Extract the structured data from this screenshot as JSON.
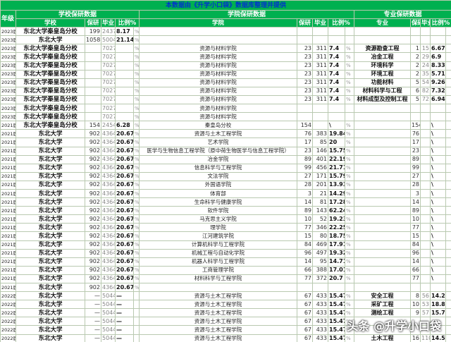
{
  "banner": "本数据由《升学小口袋》数据库整理并提供",
  "headers": {
    "year": "年级",
    "school_group": "学校保研数据",
    "college_group": "学院保研数据",
    "major_group": "专业保研数据",
    "school": "学校",
    "baoyan": "保研",
    "biye": "毕业",
    "ratio": "比例%",
    "college": "学院",
    "major": "专业"
  },
  "rows": [
    {
      "y": "2023届",
      "s": "东北大学秦皇岛分校",
      "sb": "199",
      "sg": "2437",
      "sr": "8.17",
      "sp": "%",
      "c": "",
      "cb": "",
      "cg": "",
      "cr": "",
      "cp": "",
      "m": "",
      "mb": "",
      "mg": "",
      "mr": "",
      "mp": ""
    },
    {
      "y": "2023届",
      "s": "东北大学",
      "sb": "1058",
      "sg": "5004",
      "sr": "21.14",
      "sp": "%",
      "c": "",
      "cb": "",
      "cg": "",
      "cr": "",
      "cp": "",
      "m": "",
      "mb": "",
      "mg": "",
      "mr": "",
      "mp": ""
    },
    {
      "y": "2023届",
      "s": "东北大学秦皇岛分校",
      "sb": "",
      "sg": "7027",
      "sr": "",
      "sp": "%",
      "c": "资源与材料学院",
      "cb": "23",
      "cg": "311",
      "cr": "7.4",
      "cp": "%",
      "m": "资源勘查工程",
      "mb": "1",
      "mg": "15",
      "mr": "6.67",
      "mp": ""
    },
    {
      "y": "2023届",
      "s": "东北大学秦皇岛分校",
      "sb": "",
      "sg": "7027",
      "sr": "",
      "sp": "%",
      "c": "资源与材料学院",
      "cb": "23",
      "cg": "311",
      "cr": "7.4",
      "cp": "%",
      "m": "冶金工程",
      "mb": "2",
      "mg": "29",
      "mr": "6.9",
      "mp": ""
    },
    {
      "y": "2023届",
      "s": "东北大学秦皇岛分校",
      "sb": "",
      "sg": "7027",
      "sr": "",
      "sp": "%",
      "c": "资源与材料学院",
      "cb": "23",
      "cg": "311",
      "cr": "7.4",
      "cp": "%",
      "m": "环境科学",
      "mb": "2",
      "mg": "24",
      "mr": "8.33",
      "mp": ""
    },
    {
      "y": "2023届",
      "s": "东北大学秦皇岛分校",
      "sb": "",
      "sg": "7027",
      "sr": "",
      "sp": "%",
      "c": "资源与材料学院",
      "cb": "23",
      "cg": "311",
      "cr": "7.4",
      "cp": "%",
      "m": "环境工程",
      "mb": "2",
      "mg": "35",
      "mr": "5.71",
      "mp": ""
    },
    {
      "y": "2023届",
      "s": "东北大学秦皇岛分校",
      "sb": "",
      "sg": "7027",
      "sr": "",
      "sp": "%",
      "c": "资源与材料学院",
      "cb": "23",
      "cg": "311",
      "cr": "7.4",
      "cp": "%",
      "m": "功能材料",
      "mb": "5",
      "mg": "54",
      "mr": "9.26",
      "mp": ""
    },
    {
      "y": "2023届",
      "s": "东北大学秦皇岛分校",
      "sb": "",
      "sg": "7027",
      "sr": "",
      "sp": "%",
      "c": "资源与材料学院",
      "cb": "23",
      "cg": "311",
      "cr": "7.4",
      "cp": "%",
      "m": "材料科学与工程",
      "mb": "6",
      "mg": "82",
      "mr": "7.32",
      "mp": ""
    },
    {
      "y": "2023届",
      "s": "东北大学秦皇岛分校",
      "sb": "",
      "sg": "7027",
      "sr": "",
      "sp": "%",
      "c": "资源与材料学院",
      "cb": "23",
      "cg": "311",
      "cr": "7.4",
      "cp": "%",
      "m": "材料成型及控制工程",
      "mb": "5",
      "mg": "72",
      "mr": "6.94",
      "mp": ""
    },
    {
      "y": "2023届",
      "s": "东北大学秦皇岛分校",
      "sb": "",
      "sg": "7027",
      "sr": "",
      "sp": "%",
      "c": "资源与材料学院",
      "cb": "",
      "cg": "",
      "cr": "",
      "cp": "",
      "m": "",
      "mb": "",
      "mg": "",
      "mr": "",
      "mp": ""
    },
    {
      "y": "2023届",
      "s": "东北大学秦皇岛分校",
      "sb": "",
      "sg": "7027",
      "sr": "",
      "sp": "%",
      "c": "资源与材料学院",
      "cb": "",
      "cg": "",
      "cr": "",
      "cp": "",
      "m": "",
      "mb": "",
      "mg": "",
      "mr": "",
      "mp": ""
    },
    {
      "y": "2021届",
      "s": "东北大学秦皇岛分校",
      "sb": "154",
      "sg": "2454",
      "sr": "6.28",
      "sp": "%",
      "c": "秦皇岛分校",
      "cb": "154",
      "cg": "",
      "cr": "\\",
      "cp": "%",
      "m": "",
      "mb": "154",
      "mg": "",
      "mr": "\\",
      "mp": ""
    },
    {
      "y": "2021届",
      "s": "东北大学",
      "sb": "902",
      "sg": "4364",
      "sr": "20.67",
      "sp": "%",
      "c": "资源与土木工程学院",
      "cb": "76",
      "cg": "383",
      "cr": "19.84",
      "cp": "%",
      "m": "",
      "mb": "76",
      "mg": "",
      "mr": "\\",
      "mp": ""
    },
    {
      "y": "2021届",
      "s": "东北大学",
      "sb": "902",
      "sg": "4364",
      "sr": "20.67",
      "sp": "%",
      "c": "艺术学院",
      "cb": "17",
      "cg": "85",
      "cr": "20",
      "cp": "%",
      "m": "",
      "mb": "17",
      "mg": "",
      "mr": "\\",
      "mp": ""
    },
    {
      "y": "2021届",
      "s": "东北大学",
      "sb": "902",
      "sg": "4364",
      "sr": "20.67",
      "sp": "%",
      "c": "医学与生物信息工程学院（原中荷生物医学与信息工程学院）",
      "cb": "23",
      "cg": "146",
      "cr": "15.75",
      "cp": "%",
      "m": "",
      "mb": "23",
      "mg": "",
      "mr": "\\",
      "mp": ""
    },
    {
      "y": "2021届",
      "s": "东北大学",
      "sb": "902",
      "sg": "4364",
      "sr": "20.67",
      "sp": "%",
      "c": "冶金学院",
      "cb": "89",
      "cg": "401",
      "cr": "22.19",
      "cp": "%",
      "m": "",
      "mb": "89",
      "mg": "",
      "mr": "\\",
      "mp": ""
    },
    {
      "y": "2021届",
      "s": "东北大学",
      "sb": "902",
      "sg": "4364",
      "sr": "20.67",
      "sp": "%",
      "c": "信息科学与工程学院",
      "cb": "99",
      "cg": "456",
      "cr": "21.71",
      "cp": "%",
      "m": "",
      "mb": "99",
      "mg": "",
      "mr": "\\",
      "mp": ""
    },
    {
      "y": "2021届",
      "s": "东北大学",
      "sb": "902",
      "sg": "4364",
      "sr": "20.67",
      "sp": "%",
      "c": "文法学院",
      "cb": "27",
      "cg": "171",
      "cr": "15.79",
      "cp": "%",
      "m": "",
      "mb": "27",
      "mg": "",
      "mr": "\\",
      "mp": ""
    },
    {
      "y": "2021届",
      "s": "东北大学",
      "sb": "902",
      "sg": "4364",
      "sr": "20.67",
      "sp": "%",
      "c": "外国语学院",
      "cb": "28",
      "cg": "201",
      "cr": "13.93",
      "cp": "%",
      "m": "",
      "mb": "28",
      "mg": "",
      "mr": "\\",
      "mp": ""
    },
    {
      "y": "2021届",
      "s": "东北大学",
      "sb": "902",
      "sg": "4364",
      "sr": "20.67",
      "sp": "%",
      "c": "体育部",
      "cb": "3",
      "cg": "21",
      "cr": "14.29",
      "cp": "%",
      "m": "",
      "mb": "3",
      "mg": "",
      "mr": "\\",
      "mp": ""
    },
    {
      "y": "2021届",
      "s": "东北大学",
      "sb": "902",
      "sg": "4364",
      "sr": "20.67",
      "sp": "%",
      "c": "生命科学与健康学院",
      "cb": "14",
      "cg": "81",
      "cr": "17.28",
      "cp": "%",
      "m": "",
      "mb": "14",
      "mg": "",
      "mr": "\\",
      "mp": ""
    },
    {
      "y": "2021届",
      "s": "东北大学",
      "sb": "902",
      "sg": "4364",
      "sr": "20.67",
      "sp": "%",
      "c": "软件学院",
      "cb": "89",
      "cg": "143",
      "cr": "62.24",
      "cp": "%",
      "m": "",
      "mb": "89",
      "mg": "",
      "mr": "\\",
      "mp": ""
    },
    {
      "y": "2021届",
      "s": "东北大学",
      "sb": "902",
      "sg": "4364",
      "sr": "20.67",
      "sp": "%",
      "c": "马克思主义学院",
      "cb": "10",
      "cg": "52",
      "cr": "19.23",
      "cp": "%",
      "m": "",
      "mb": "10",
      "mg": "",
      "mr": "\\",
      "mp": ""
    },
    {
      "y": "2021届",
      "s": "东北大学",
      "sb": "902",
      "sg": "4364",
      "sr": "20.67",
      "sp": "%",
      "c": "理学院",
      "cb": "77",
      "cg": "346",
      "cr": "22.25",
      "cp": "%",
      "m": "",
      "mb": "77",
      "mg": "",
      "mr": "\\",
      "mp": ""
    },
    {
      "y": "2021届",
      "s": "东北大学",
      "sb": "902",
      "sg": "4364",
      "sr": "20.67",
      "sp": "%",
      "c": "江河建筑学院",
      "cb": "15",
      "cg": "80",
      "cr": "18.75",
      "cp": "%",
      "m": "",
      "mb": "15",
      "mg": "",
      "mr": "\\",
      "mp": ""
    },
    {
      "y": "2021届",
      "s": "东北大学",
      "sb": "902",
      "sg": "4364",
      "sr": "20.67",
      "sp": "%",
      "c": "计算机科学与工程学院",
      "cb": "84",
      "cg": "469",
      "cr": "17.91",
      "cp": "%",
      "m": "",
      "mb": "84",
      "mg": "",
      "mr": "\\",
      "mp": ""
    },
    {
      "y": "2021届",
      "s": "东北大学",
      "sb": "902",
      "sg": "4364",
      "sr": "20.67",
      "sp": "%",
      "c": "机械工程与自动化学院",
      "cb": "96",
      "cg": "497",
      "cr": "19.32",
      "cp": "%",
      "m": "",
      "mb": "96",
      "mg": "",
      "mr": "\\",
      "mp": ""
    },
    {
      "y": "2021届",
      "s": "东北大学",
      "sb": "902",
      "sg": "4364",
      "sr": "20.67",
      "sp": "%",
      "c": "机器人科学与工程学院",
      "cb": "14",
      "cg": "95",
      "cr": "14.71",
      "cp": "%",
      "m": "",
      "mb": "14",
      "mg": "",
      "mr": "\\",
      "mp": ""
    },
    {
      "y": "2021届",
      "s": "东北大学",
      "sb": "902",
      "sg": "4364",
      "sr": "20.67",
      "sp": "%",
      "c": "工商管理学院",
      "cb": "66",
      "cg": "388",
      "cr": "17.01",
      "cp": "%",
      "m": "",
      "mb": "66",
      "mg": "",
      "mr": "\\",
      "mp": ""
    },
    {
      "y": "2021届",
      "s": "东北大学",
      "sb": "902",
      "sg": "4364",
      "sr": "20.67",
      "sp": "%",
      "c": "材料科学与工程学院",
      "cb": "77",
      "cg": "372",
      "cr": "20.7",
      "cp": "%",
      "m": "",
      "mb": "77",
      "mg": "",
      "mr": "\\",
      "mp": ""
    },
    {
      "y": "2021届",
      "s": "东北大学",
      "sb": "902",
      "sg": "4364",
      "sr": "20.67",
      "sp": "%",
      "c": "",
      "cb": "",
      "cg": "",
      "cr": "",
      "cp": "",
      "m": "",
      "mb": "",
      "mg": "",
      "mr": "",
      "mp": ""
    },
    {
      "y": "2022届",
      "s": "东北大学",
      "sb": "—",
      "sg": "5044",
      "sr": "—",
      "sp": "",
      "c": "资源与土木工程学院",
      "cb": "67",
      "cg": "433",
      "cr": "15.47",
      "cp": "%",
      "m": "安全工程",
      "mb": "8",
      "mg": "56",
      "mr": "14.29",
      "mp": ""
    },
    {
      "y": "2022届",
      "s": "东北大学",
      "sb": "—",
      "sg": "5044",
      "sr": "—",
      "sp": "",
      "c": "资源与土木工程学院",
      "cb": "67",
      "cg": "433",
      "cr": "15.47",
      "cp": "%",
      "m": "采矿工程",
      "mb": "10",
      "mg": "53",
      "mr": "18.87",
      "mp": ""
    },
    {
      "y": "2022届",
      "s": "东北大学",
      "sb": "—",
      "sg": "5044",
      "sr": "—",
      "sp": "",
      "c": "资源与土木工程学院",
      "cb": "67",
      "cg": "433",
      "cr": "15.47",
      "cp": "%",
      "m": "测绘工程",
      "mb": "9",
      "mg": "57",
      "mr": "15.79",
      "mp": ""
    },
    {
      "y": "2022届",
      "s": "东北大学",
      "sb": "—",
      "sg": "5044",
      "sr": "—",
      "sp": "",
      "c": "资源与土木工程学院",
      "cb": "67",
      "cg": "433",
      "cr": "15.47",
      "cp": "%",
      "m": "",
      "mb": "",
      "mg": "",
      "mr": "",
      "mp": ""
    },
    {
      "y": "2022届",
      "s": "东北大学",
      "sb": "—",
      "sg": "5044",
      "sr": "—",
      "sp": "",
      "c": "资源与土木工程学院",
      "cb": "67",
      "cg": "433",
      "cr": "15.47",
      "cp": "%",
      "m": "",
      "mb": "",
      "mg": "",
      "mr": "",
      "mp": ""
    },
    {
      "y": "2022届",
      "s": "东北大学",
      "sb": "—",
      "sg": "5044",
      "sr": "—",
      "sp": "",
      "c": "资源与土木工程学院",
      "cb": "67",
      "cg": "433",
      "cr": "15.47",
      "cp": "%",
      "m": "土木工程",
      "mb": "16",
      "mg": "110",
      "mr": "14.55",
      "mp": ""
    }
  ],
  "watermark": "头条 @升学小口袋"
}
